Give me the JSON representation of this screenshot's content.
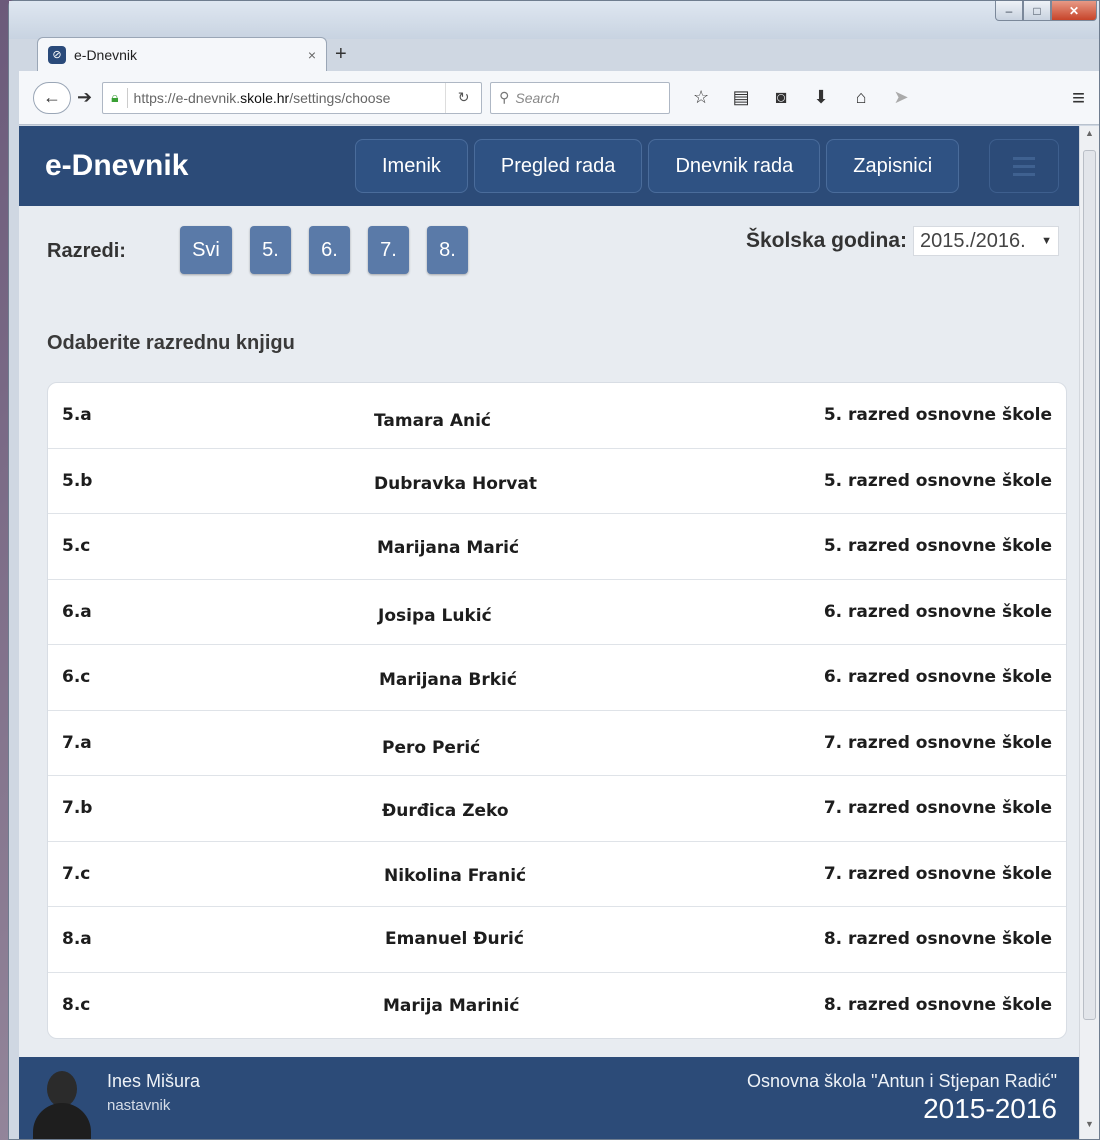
{
  "browser": {
    "tab_title": "e-Dnevnik",
    "tab_close": "×",
    "new_tab": "+",
    "url_prefix": "https://e-dnevnik.",
    "url_domain": "skole.hr",
    "url_path": "/settings/choose",
    "search_placeholder": "Search"
  },
  "app": {
    "brand": "e-Dnevnik",
    "nav": [
      "Imenik",
      "Pregled rada",
      "Dnevnik rada",
      "Zapisnici"
    ]
  },
  "filters": {
    "razredi_label": "Razredi:",
    "grades": [
      "Svi",
      "5.",
      "6.",
      "7.",
      "8."
    ],
    "year_label": "Školska godina:",
    "year_value": "2015./2016."
  },
  "section_title": "Odaberite razrednu knjigu",
  "classes": [
    {
      "code": "5.a",
      "teacher": "Tamara Anić",
      "grade": "5. razred osnovne škole"
    },
    {
      "code": "5.b",
      "teacher": "Dubravka Horvat",
      "grade": "5. razred osnovne škole"
    },
    {
      "code": "5.c",
      "teacher": "Marijana Marić",
      "grade": "5. razred osnovne škole"
    },
    {
      "code": "6.a",
      "teacher": "Josipa Lukić",
      "grade": "6. razred osnovne škole"
    },
    {
      "code": "6.c",
      "teacher": "Marijana Brkić",
      "grade": "6. razred osnovne škole"
    },
    {
      "code": "7.a",
      "teacher": "Pero Perić",
      "grade": "7. razred osnovne škole"
    },
    {
      "code": "7.b",
      "teacher": "Đurđica Zeko",
      "grade": "7. razred osnovne škole"
    },
    {
      "code": "7.c",
      "teacher": "Nikolina Franić",
      "grade": "7. razred osnovne škole"
    },
    {
      "code": "8.a",
      "teacher": "Emanuel Đurić",
      "grade": "8. razred osnovne škole"
    },
    {
      "code": "8.c",
      "teacher": "Marija Marinić",
      "grade": "8. razred osnovne škole"
    }
  ],
  "footer": {
    "user_name": "Ines Mišura",
    "user_role": "nastavnik",
    "school_name": "Osnovna škola \"Antun i Stjepan Radić\"",
    "school_year": "2015-2016"
  },
  "colors": {
    "brand_blue": "#2c4b78",
    "grade_button": "#5a7aa8",
    "page_bg": "#e8ecf1"
  },
  "icons": [
    "favicon-icon",
    "back-icon",
    "forward-icon",
    "lock-icon",
    "reload-icon",
    "search-icon",
    "star-icon",
    "reading-list-icon",
    "pocket-icon",
    "download-icon",
    "home-icon",
    "send-icon",
    "menu-icon",
    "hamburger-icon",
    "avatar-icon"
  ]
}
